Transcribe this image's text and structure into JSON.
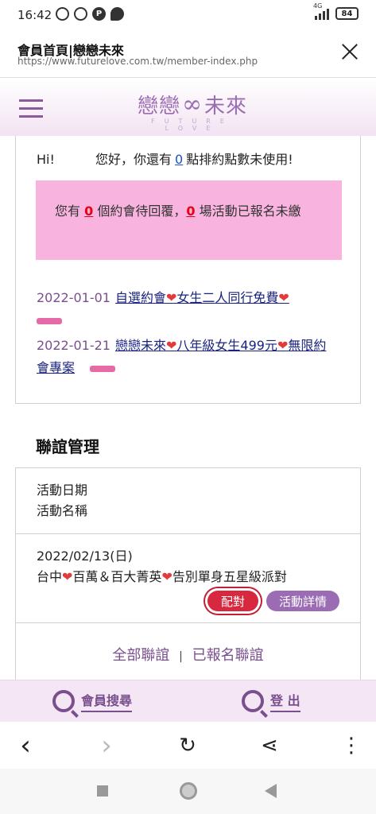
{
  "status_bar": {
    "time": "16:42",
    "p_badge": "P",
    "network": "4G",
    "battery": "84"
  },
  "browser": {
    "page_title": "會員首頁|戀戀未來",
    "url": "https://www.futurelove.com.tw/member-index.php"
  },
  "site": {
    "logo_text_left": "戀戀",
    "logo_symbol": "∞",
    "logo_text_right": "未來",
    "logo_subtitle": "FUTURE LOVE"
  },
  "greeting": {
    "hi": "Hi!",
    "prefix": "您好，你還有",
    "points": "0",
    "suffix": "點排約點數未使用!"
  },
  "notice": {
    "part1": "您有",
    "pending_dates": "0",
    "part2": "個約會待回覆，",
    "registered_events": "0",
    "part3": "場活動已報名未繳"
  },
  "news": [
    {
      "date": "2022-01-01",
      "text_a": "自選約會",
      "text_b": "女生二人同行免費"
    },
    {
      "date": "2022-01-21",
      "text_a": "戀戀未來",
      "text_b": "八年級女生499元",
      "text_c": "無限約會專案"
    }
  ],
  "heart": "❤",
  "social": {
    "section_title": "聯誼管理",
    "col_date": "活動日期",
    "col_name": "活動名稱",
    "event": {
      "date": "2022/02/13(日)",
      "name_a": "台中",
      "name_b": "百萬＆百大菁英",
      "name_c": "告別單身五星級派對",
      "match_label": "配對",
      "detail_label": "活動詳情"
    },
    "link_all": "全部聯誼",
    "link_sep": "|",
    "link_registered": "已報名聯誼"
  },
  "site_nav": {
    "member_search": "會員搜尋",
    "logout": "登 出"
  },
  "toolbar": {
    "back": "‹",
    "forward": "›",
    "refresh": "↻",
    "share": "⋖",
    "more": "⋮"
  }
}
